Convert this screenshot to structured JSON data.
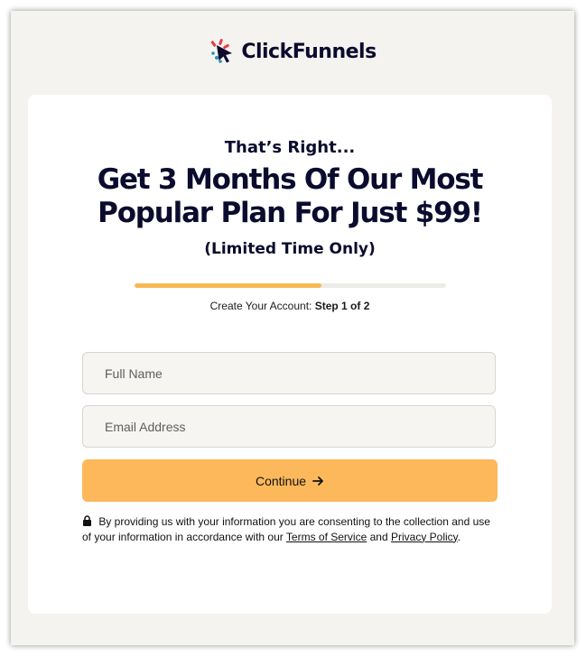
{
  "brand": {
    "name": "ClickFunnels",
    "colors": {
      "navy": "#0b0b2e",
      "red": "#e83a45",
      "teal": "#2f8fb4",
      "accent": "#fcb85a"
    }
  },
  "hero": {
    "eyebrow": "That’s Right...",
    "headline": "Get 3 Months Of Our Most Popular Plan For Just $99!",
    "subheadline": "(Limited Time Only)"
  },
  "progress": {
    "fraction": 0.6,
    "label_prefix": "Create Your Account:",
    "label_step": "Step 1 of 2"
  },
  "form": {
    "full_name_placeholder": "Full Name",
    "email_placeholder": "Email Address",
    "continue_label": "Continue",
    "continue_icon": "arrow-right-icon"
  },
  "legal": {
    "icon": "lock-icon",
    "text_before": "By providing us with your information you are consenting to the collection and use of your information in accordance with our",
    "terms_link": "Terms of Service",
    "and": "and",
    "privacy_link": "Privacy Policy",
    "end": "."
  }
}
